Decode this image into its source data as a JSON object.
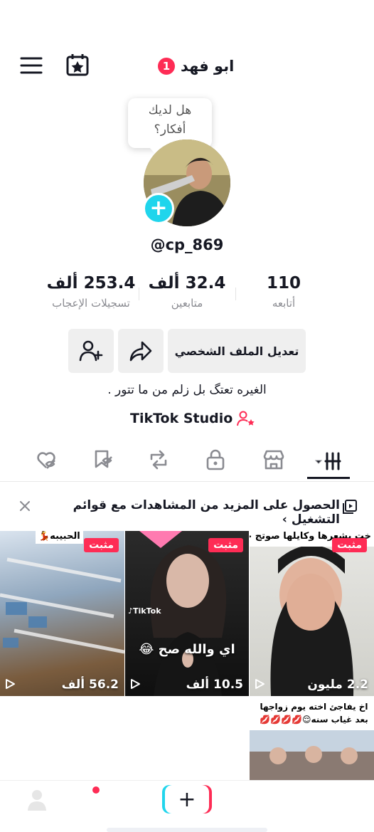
{
  "header": {
    "username": "ابو فهد",
    "notification_count": "1"
  },
  "ideas_bubble": {
    "line1": "هل لديك",
    "line2": "أفكار؟"
  },
  "profile": {
    "handle": "@cp_869"
  },
  "stats": [
    {
      "value": "110",
      "label": "أتابعه"
    },
    {
      "value": "32.4 ألف",
      "label": "متابعين"
    },
    {
      "value": "253.4 ألف",
      "label": "تسجيلات الإعجاب"
    }
  ],
  "actions": {
    "edit_profile": "تعديل الملف الشخصي"
  },
  "bio": "الغيره تعتگ بل زلم من ما تتور .",
  "studio_link": "TikTok Studio",
  "banner": {
    "text": "الحصول على المزيد من المشاهدات مع قوائم التشغيل ›"
  },
  "videos": [
    {
      "pinned_label": "مثبت",
      "views": "2.2 مليون",
      "caption": "خت بشعرها وكايلها صوتج حلو",
      "overlay": ""
    },
    {
      "pinned_label": "مثبت",
      "views": "10.5 ألف",
      "caption": "",
      "overlay": "اي والله صح 😂"
    },
    {
      "pinned_label": "مثبت",
      "views": "56.2 ألف",
      "caption": "الحبيبه💃",
      "overlay": ""
    },
    {
      "pinned_label": "",
      "views": "",
      "caption": "",
      "overlay": "اخ يفاجئ اخته يوم زواجها بعد غياب سنه😌💋💋💋💋"
    }
  ],
  "colors": {
    "accent_red": "#fe2c55",
    "accent_cyan": "#20d5ec",
    "text": "#161823",
    "muted": "#8a8b91"
  }
}
